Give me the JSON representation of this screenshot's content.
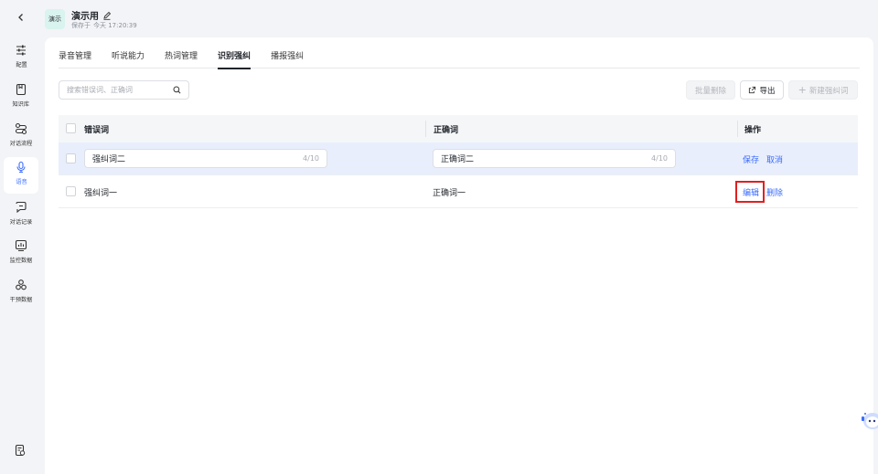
{
  "app": {
    "badge": "演示",
    "title": "演示用",
    "saved_label": "保存于",
    "saved_time": "今天 17:20:39"
  },
  "sidebar": {
    "items": [
      {
        "label": "配置",
        "icon": "sliders-icon"
      },
      {
        "label": "知识库",
        "icon": "book-icon"
      },
      {
        "label": "对话流程",
        "icon": "flow-icon"
      },
      {
        "label": "语音",
        "icon": "microphone-icon"
      },
      {
        "label": "对话记录",
        "icon": "chat-icon"
      },
      {
        "label": "监控数据",
        "icon": "chart-icon"
      },
      {
        "label": "干预数据",
        "icon": "nodes-icon"
      }
    ],
    "active_index": 3
  },
  "tabs": [
    {
      "label": "录音管理"
    },
    {
      "label": "听说能力"
    },
    {
      "label": "热词管理"
    },
    {
      "label": "识别强纠"
    },
    {
      "label": "播报强纠"
    }
  ],
  "active_tab": 3,
  "toolbar": {
    "search_placeholder": "搜索错误词、正确词",
    "batch_delete_label": "批量删除",
    "export_label": "导出",
    "new_label": "新建强纠词"
  },
  "table": {
    "headers": {
      "wrong": "错误词",
      "correct": "正确词",
      "actions": "操作"
    },
    "editing_row": {
      "wrong": "强纠词二",
      "wrong_count": "4/10",
      "correct": "正确词二",
      "correct_count": "4/10",
      "save_label": "保存",
      "cancel_label": "取消"
    },
    "rows": [
      {
        "wrong": "强纠词一",
        "correct": "正确词一",
        "edit_label": "编辑",
        "delete_label": "删除"
      }
    ]
  },
  "colors": {
    "accent": "#3b6cff",
    "highlight": "#e02020",
    "badge_bg": "#d9f3ee"
  }
}
